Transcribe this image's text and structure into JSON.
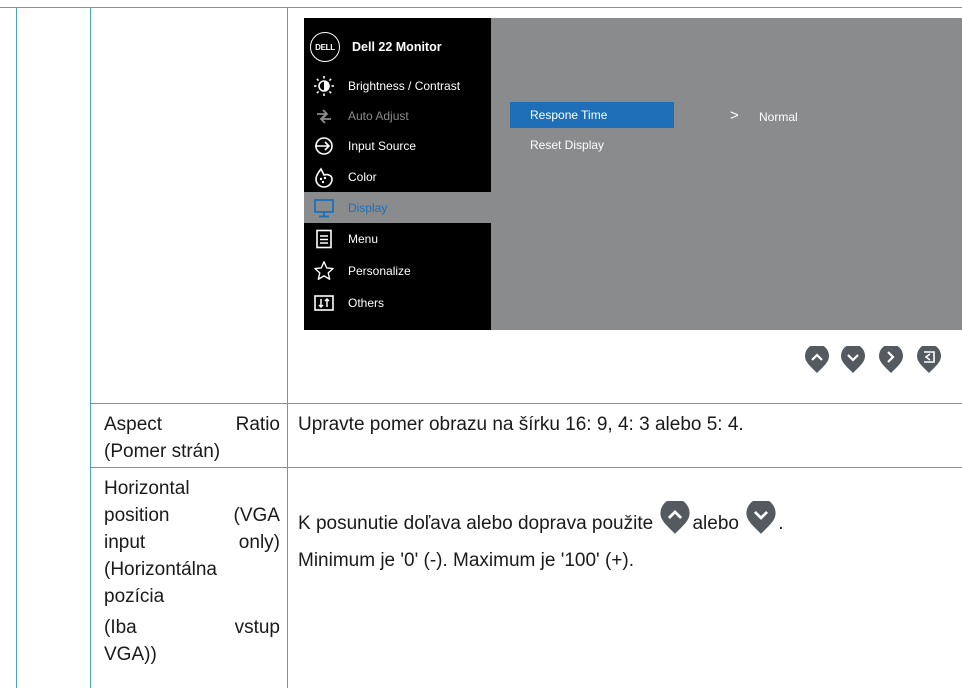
{
  "osd": {
    "title": "Dell 22 Monitor",
    "logo_text": "DELL",
    "menu_items": [
      {
        "label": "Brightness / Contrast",
        "icon": "brightness-icon"
      },
      {
        "label": "Auto Adjust",
        "icon": "auto-adjust-icon"
      },
      {
        "label": "Input Source",
        "icon": "input-source-icon"
      },
      {
        "label": "Color",
        "icon": "color-icon"
      },
      {
        "label": "Display",
        "icon": "display-icon"
      },
      {
        "label": "Menu",
        "icon": "menu-icon"
      },
      {
        "label": "Personalize",
        "icon": "star-icon"
      },
      {
        "label": "Others",
        "icon": "others-icon"
      }
    ],
    "active_menu": "Display",
    "submenu": [
      {
        "label": "Respone Time"
      },
      {
        "label": "Reset Display"
      }
    ],
    "selected_value_arrow": ">",
    "selected_value": "Normal",
    "colors": {
      "osd_bg": "#000000",
      "panel_bg": "#898b8d",
      "highlight": "#1f6fb8"
    }
  },
  "buttons": [
    "up-arrow-icon",
    "down-arrow-icon",
    "right-arrow-icon",
    "back-icon"
  ],
  "table": {
    "rows": [
      {
        "label_lines": [
          "Aspect Ratio",
          "(Pomer strán)"
        ],
        "description": "Upravte pomer obrazu na šírku 16: 9, 4: 3 alebo 5: 4."
      },
      {
        "label_lines": [
          "Horizontal",
          "position (VGA",
          "input only)",
          "(Horizontálna",
          "pozícia",
          "(Iba vstup",
          "VGA))"
        ],
        "description_parts": [
          "K posunutie doľava alebo doprava použite",
          "alebo",
          "."
        ],
        "description_line2": "Minimum je '0' (-). Maximum je '100' (+)."
      }
    ]
  }
}
